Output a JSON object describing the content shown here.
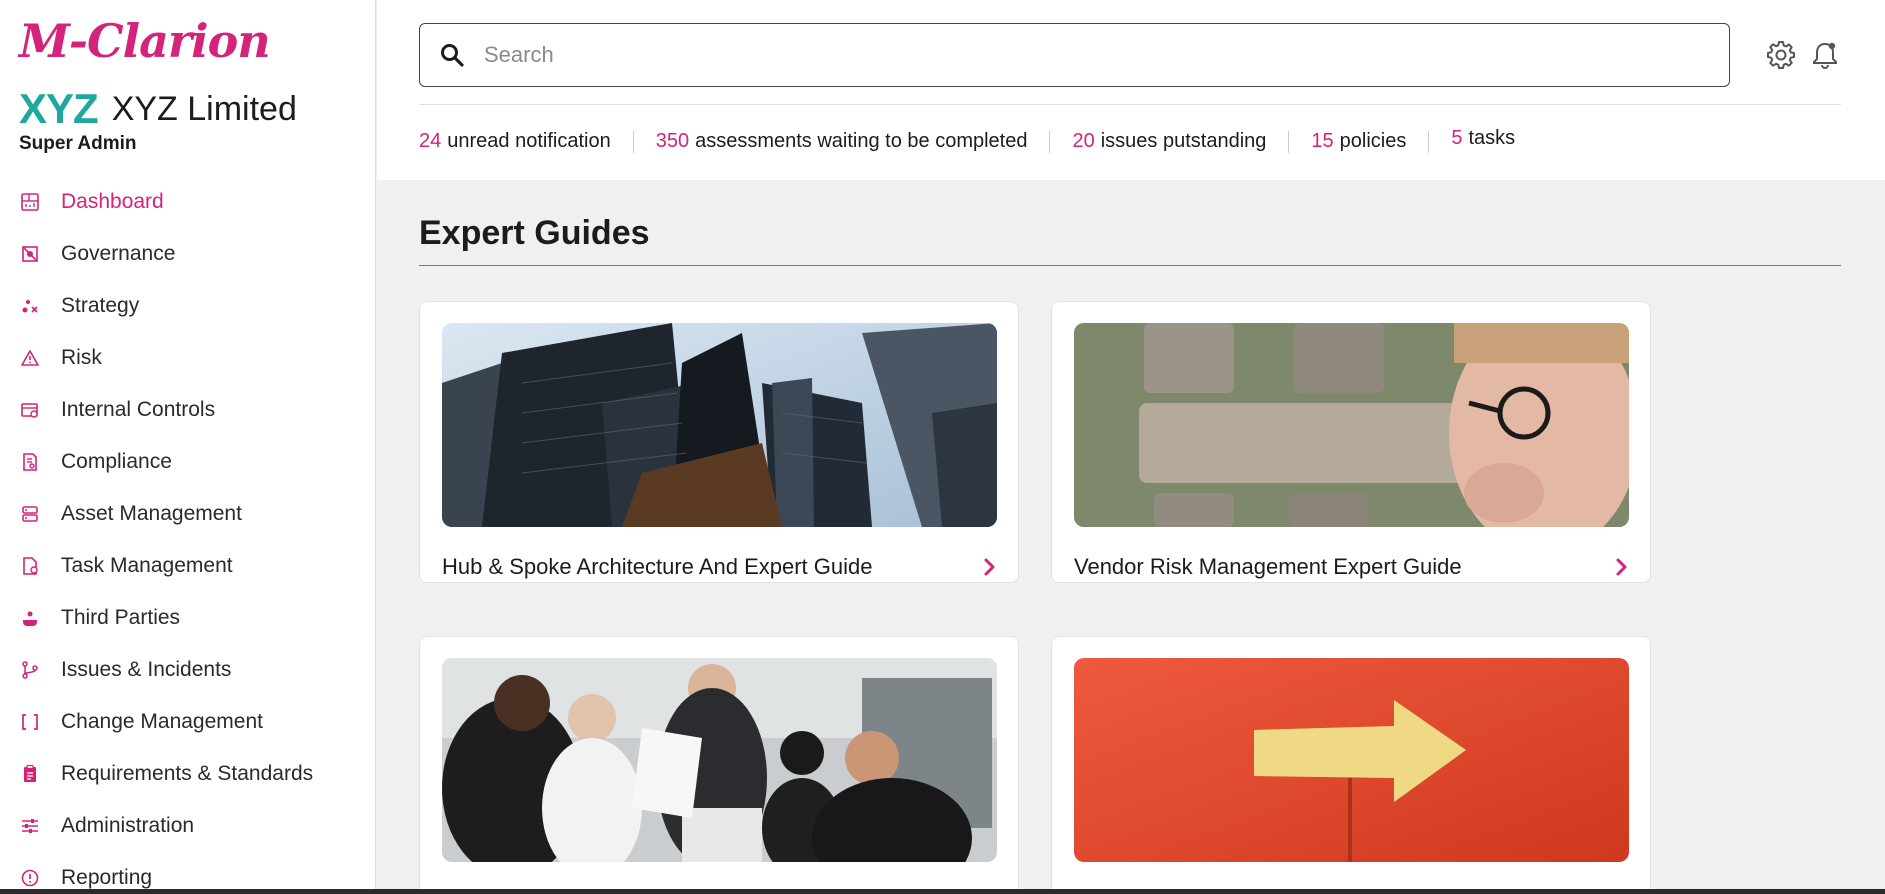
{
  "sidebar": {
    "brand": "M-Clarion",
    "company_logo": "XYZ",
    "company_name": "XYZ Limited",
    "role": "Super Admin",
    "items": [
      {
        "label": "Dashboard",
        "icon": "dashboard-icon",
        "active": true
      },
      {
        "label": "Governance",
        "icon": "governance-icon"
      },
      {
        "label": "Strategy",
        "icon": "strategy-icon"
      },
      {
        "label": "Risk",
        "icon": "warning-icon"
      },
      {
        "label": "Internal Controls",
        "icon": "controls-icon"
      },
      {
        "label": "Compliance",
        "icon": "compliance-icon"
      },
      {
        "label": "Asset Management",
        "icon": "asset-icon"
      },
      {
        "label": "Task Management",
        "icon": "task-icon"
      },
      {
        "label": "Third Parties",
        "icon": "third-parties-icon"
      },
      {
        "label": "Issues & Incidents",
        "icon": "branch-icon"
      },
      {
        "label": "Change Management",
        "icon": "change-icon"
      },
      {
        "label": "Requirements & Standards",
        "icon": "clipboard-icon"
      },
      {
        "label": "Administration",
        "icon": "sliders-icon"
      },
      {
        "label": "Reporting",
        "icon": "reporting-icon"
      }
    ]
  },
  "search": {
    "placeholder": "Search"
  },
  "header_icons": [
    "gear-icon",
    "bell-icon"
  ],
  "stats": [
    {
      "value": "24",
      "label": "unread notification"
    },
    {
      "value": "350",
      "label": "assessments waiting to be completed"
    },
    {
      "value": "20",
      "label": "issues putstanding"
    },
    {
      "value": "15",
      "label": "policies"
    },
    {
      "value": "5",
      "label": "tasks"
    }
  ],
  "main": {
    "section_title": "Expert Guides",
    "cards": [
      {
        "title": "Hub & Spoke Architecture And Expert Guide",
        "image": "skyscrapers-photo"
      },
      {
        "title": "Vendor Risk Management Expert Guide",
        "image": "wooden-blocks-photo"
      },
      {
        "title": "",
        "image": "business-meeting-photo"
      },
      {
        "title": "",
        "image": "yellow-arrow-photo"
      }
    ]
  },
  "colors": {
    "accent": "#d4237a",
    "logo_teal": "#1fa7a0",
    "background": "#f0f0f0"
  }
}
